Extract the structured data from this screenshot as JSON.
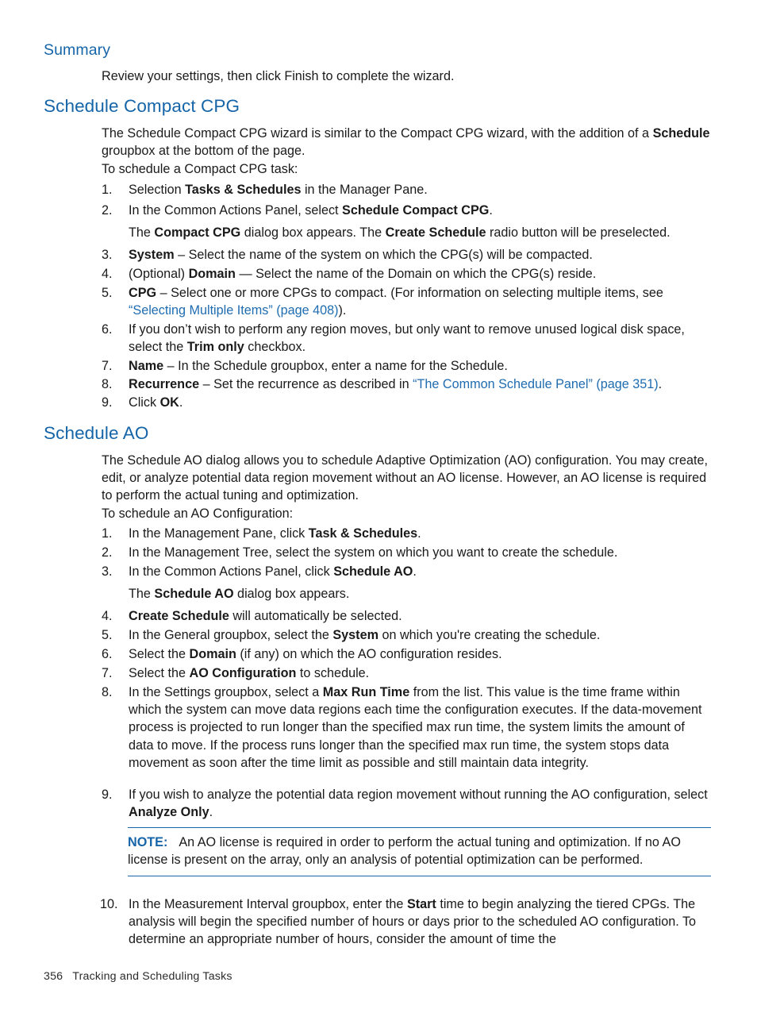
{
  "document": {
    "footer": {
      "page_number": "356",
      "section_title": "Tracking and Scheduling Tasks"
    },
    "colors": {
      "heading": "#1565a8",
      "link": "#1f6cb0",
      "note_rule": "#1565a8",
      "body_text": "#1a1a1a"
    }
  },
  "summary_section": {
    "heading": "Summary",
    "paragraph": "Review your settings, then click Finish to complete the wizard."
  },
  "schedule_compact_cpg": {
    "heading": "Schedule Compact CPG",
    "intro_prefix": "The Schedule Compact CPG wizard is similar to the Compact CPG wizard, with the addition of a ",
    "intro_bold": "Schedule",
    "intro_suffix": " groupbox at the bottom of the page.",
    "lead_in": "To schedule a Compact CPG task:",
    "steps": {
      "s1": {
        "num": "1.",
        "pre": "Selection ",
        "bold": "Tasks & Schedules",
        "post": " in the Manager Pane."
      },
      "s2": {
        "num": "2.",
        "pre": "In the Common Actions Panel, select ",
        "bold": "Schedule Compact CPG",
        "post": "."
      },
      "s2_note": {
        "pre": "The ",
        "bold1": "Compact CPG",
        "mid": " dialog box appears. The ",
        "bold2": "Create Schedule",
        "post": " radio button will be preselected."
      },
      "s3": {
        "num": "3.",
        "bold": "System",
        "post": " – Select the name of the system on which the CPG(s) will be compacted."
      },
      "s4": {
        "num": "4.",
        "pre": "(Optional) ",
        "bold": "Domain",
        "post": " — Select the name of the Domain on which the CPG(s) reside."
      },
      "s5": {
        "num": "5.",
        "bold": "CPG",
        "mid": " – Select one or more CPGs to compact. (For information on selecting multiple items, see ",
        "link": "“Selecting Multiple Items” (page 408)",
        "post": ")."
      },
      "s6": {
        "num": "6.",
        "pre": "If you don’t wish to perform any region moves, but only want to remove unused logical disk space, select the ",
        "bold": "Trim only",
        "post": " checkbox."
      },
      "s7": {
        "num": "7.",
        "bold": "Name",
        "post": " – In the Schedule groupbox, enter a name for the Schedule."
      },
      "s8": {
        "num": "8.",
        "bold": "Recurrence",
        "mid": " – Set the recurrence as described in ",
        "link": "“The Common Schedule Panel” (page 351)",
        "post": "."
      },
      "s9": {
        "num": "9.",
        "pre": "Click ",
        "bold": "OK",
        "post": "."
      }
    }
  },
  "schedule_ao": {
    "heading": "Schedule AO",
    "intro": "The Schedule AO dialog allows you to schedule Adaptive Optimization (AO) configuration. You may create, edit, or analyze potential data region movement without an AO license. However, an AO license is required to perform the actual tuning and optimization.",
    "lead_in": "To schedule an AO Configuration:",
    "steps": {
      "s1": {
        "num": "1.",
        "pre": "In the Management Pane, click ",
        "bold": "Task & Schedules",
        "post": "."
      },
      "s2": {
        "num": "2.",
        "text": "In the Management Tree, select the system on which you want to create the schedule."
      },
      "s3": {
        "num": "3.",
        "pre": "In the Common Actions Panel, click ",
        "bold": "Schedule AO",
        "post": "."
      },
      "s3_note": {
        "pre": "The ",
        "bold": "Schedule AO",
        "post": " dialog box appears."
      },
      "s4": {
        "num": "4.",
        "bold": "Create Schedule",
        "post": " will automatically be selected."
      },
      "s5": {
        "num": "5.",
        "pre": "In the General groupbox, select the ",
        "bold": "System",
        "post": " on which you're creating the schedule."
      },
      "s6": {
        "num": "6.",
        "pre": "Select the ",
        "bold": "Domain",
        "post": " (if any) on which the AO configuration resides."
      },
      "s7": {
        "num": "7.",
        "pre": "Select the ",
        "bold": "AO Configuration",
        "post": " to schedule."
      },
      "s8": {
        "num": "8.",
        "pre": "In the Settings groupbox, select a ",
        "bold": "Max Run Time",
        "post": " from the list. This value is the time frame within which the system can move data regions each time the configuration executes. If the data-movement process is projected to run longer than the specified max run time, the system limits the amount of data to move. If the process runs longer than the specified max run time, the system stops data movement as soon after the time limit as possible and still maintain data integrity."
      },
      "s9": {
        "num": "9.",
        "pre": "If you wish to analyze the potential data region movement without running the AO configuration, select ",
        "bold": "Analyze Only",
        "post": "."
      },
      "s10": {
        "num": "10.",
        "pre": "In the Measurement Interval groupbox, enter the ",
        "bold": "Start",
        "post": " time to begin analyzing the tiered CPGs. The analysis will begin the specified number of hours or days prior to the scheduled AO configuration. To determine an appropriate number of hours, consider the amount of time the"
      }
    },
    "note": {
      "label": "NOTE:",
      "text": "An AO license is required in order to perform the actual tuning and optimization. If no AO license is present on the array, only an analysis of potential optimization can be performed."
    }
  }
}
